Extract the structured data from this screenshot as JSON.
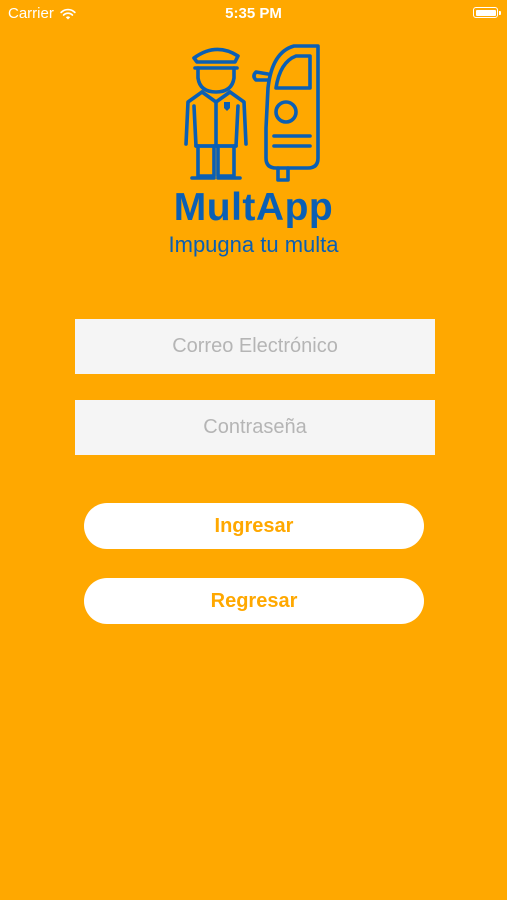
{
  "status_bar": {
    "carrier": "Carrier",
    "time": "5:35 PM",
    "wifi_icon": "wifi-icon",
    "battery_icon": "battery-icon"
  },
  "brand": {
    "logo_icon": "officer-and-car-icon",
    "name": "MultApp",
    "tagline": "Impugna tu multa"
  },
  "form": {
    "email_placeholder": "Correo Electrónico",
    "email_value": "",
    "password_placeholder": "Contraseña",
    "password_value": ""
  },
  "buttons": {
    "login_label": "Ingresar",
    "back_label": "Regresar"
  },
  "colors": {
    "background": "#FFA800",
    "brand_blue": "#0A5FB4",
    "field_background": "#F5F5F5",
    "button_background": "#FFFFFF",
    "button_text": "#FFA800"
  }
}
